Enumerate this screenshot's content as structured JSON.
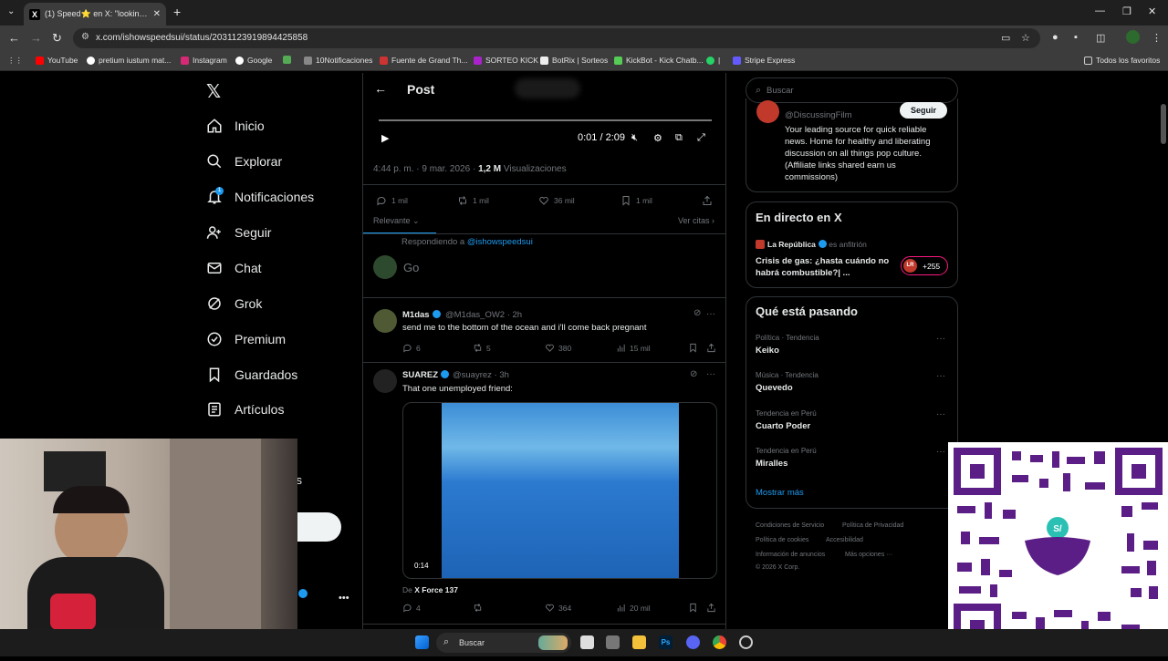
{
  "browser": {
    "tab_title": "(1) Speed⭐ en X: \"looking for",
    "url": "x.com/ishowspeedsui/status/2031123919894425858",
    "bookmarks": [
      "YouTube",
      "pretium iustum mat...",
      "Instagram",
      "Google",
      "10Notificaciones",
      "Fuente de Grand Th...",
      "SORTEO KICK",
      "BotRix | Sorteos",
      "KickBot - Kick Chatb...",
      "|",
      "Stripe Express"
    ],
    "all_favorites": "Todos los favoritos"
  },
  "nav": {
    "items": [
      "Inicio",
      "Explorar",
      "Notificaciones",
      "Seguir",
      "Chat",
      "Grok",
      "Premium",
      "Guardados",
      "Artículos"
    ],
    "notif_badge": "1",
    "partial_label": "nes"
  },
  "post": {
    "header_title": "Post",
    "video_time": "0:01 / 2:09",
    "meta_time": "4:44 p. m. · 9 mar. 2026 · ",
    "meta_views": "1,2 M",
    "meta_views_label": " Visualizaciones",
    "stats": {
      "replies": "1 mil",
      "reposts": "1 mil",
      "likes": "36 mil",
      "bookmarks": "1 mil"
    },
    "sort_label": "Relevante",
    "quotes_label": "Ver citas",
    "replying_prefix": "Respondiendo a ",
    "replying_handle": "@ishowspeedsui",
    "compose_placeholder": "Go"
  },
  "replies": [
    {
      "name": "M1das",
      "handle": "@M1das_OW2 · 2h",
      "text": "send me to the bottom of the ocean and i'll come back pregnant",
      "replies": "6",
      "reposts": "5",
      "likes": "380",
      "views": "15 mil"
    },
    {
      "name": "SUAREZ",
      "handle": "@suayrez · 3h",
      "text": "That one unemployed friend:",
      "video_time": "0:14",
      "from_prefix": "De ",
      "from_source": "X Force 137",
      "replies": "4",
      "likes": "364",
      "views": "20 mil"
    }
  ],
  "sidebar": {
    "search_placeholder": "Buscar",
    "follow_card": {
      "handle": "@DiscussingFilm",
      "follow_label": "Seguir",
      "bio": "Your leading source for quick reliable news. Home for healthy and liberating discussion on all things pop culture. (Affiliate links shared earn us commissions)"
    },
    "live": {
      "title": "En directo en X",
      "host": "La República",
      "host_suffix": "es anfitrión",
      "headline": "Crisis de gas: ¿hasta cuándo no habrá combustible?| ...",
      "listeners": "+255"
    },
    "trends": {
      "title": "Qué está pasando",
      "items": [
        {
          "category": "Política · Tendencia",
          "name": "Keiko"
        },
        {
          "category": "Música · Tendencia",
          "name": "Quevedo"
        },
        {
          "category": "Tendencia en Perú",
          "name": "Cuarto Poder"
        },
        {
          "category": "Tendencia en Perú",
          "name": "Miralles"
        }
      ],
      "show_more": "Mostrar más"
    },
    "footer": [
      "Condiciones de Servicio",
      "Política de Privacidad",
      "Política de cookies",
      "Accesibilidad",
      "Información de anuncios",
      "Más opciones ···",
      "© 2026 X Corp."
    ]
  },
  "taskbar": {
    "search_placeholder": "Buscar"
  },
  "colors": {
    "accent": "#1d9bf0",
    "bg": "#000000",
    "muted": "#71767b"
  }
}
